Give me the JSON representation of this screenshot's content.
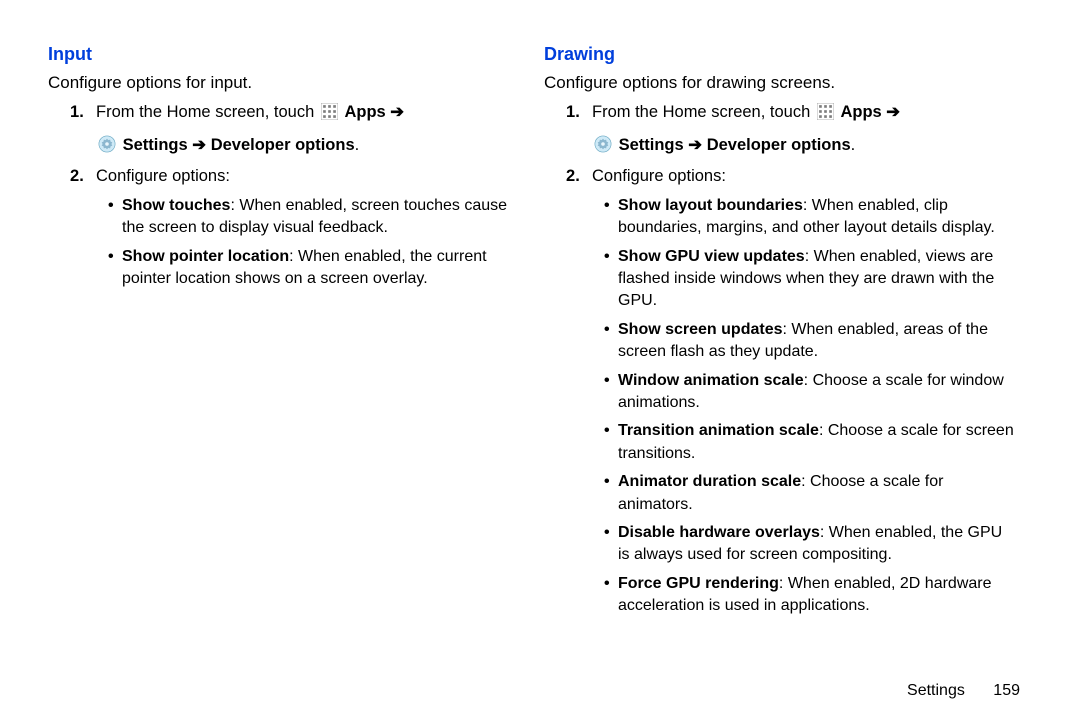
{
  "left": {
    "heading": "Input",
    "intro": "Configure options for input.",
    "step1_pre": "From the Home screen, touch",
    "apps_label": "Apps",
    "settings_label": "Settings",
    "dev_label": "Developer options",
    "arrow": "➔",
    "period": ".",
    "step2": "Configure options:",
    "bullets": [
      {
        "term": "Show touches",
        "desc": ": When enabled, screen touches cause the screen to display visual feedback."
      },
      {
        "term": "Show pointer location",
        "desc": ": When enabled, the current pointer location shows on a screen overlay."
      }
    ]
  },
  "right": {
    "heading": "Drawing",
    "intro": "Configure options for drawing screens.",
    "step1_pre": "From the Home screen, touch",
    "apps_label": "Apps",
    "settings_label": "Settings",
    "dev_label": "Developer options",
    "arrow": "➔",
    "period": ".",
    "step2": "Configure options:",
    "bullets": [
      {
        "term": "Show layout boundaries",
        "desc": ": When enabled, clip boundaries, margins, and other layout details display."
      },
      {
        "term": "Show GPU view updates",
        "desc": ": When enabled, views are flashed inside windows when they are drawn with the GPU."
      },
      {
        "term": "Show screen updates",
        "desc": ": When enabled, areas of the screen flash as they update."
      },
      {
        "term": "Window animation scale",
        "desc": ": Choose a scale for window animations."
      },
      {
        "term": "Transition animation scale",
        "desc": ": Choose a scale for screen transitions."
      },
      {
        "term": "Animator duration scale",
        "desc": ": Choose a scale for animators."
      },
      {
        "term": "Disable hardware overlays",
        "desc": ": When enabled, the GPU is always used for screen compositing."
      },
      {
        "term": "Force GPU rendering",
        "desc": ": When enabled, 2D hardware acceleration is used in applications."
      }
    ]
  },
  "footer": {
    "section": "Settings",
    "page": "159"
  }
}
